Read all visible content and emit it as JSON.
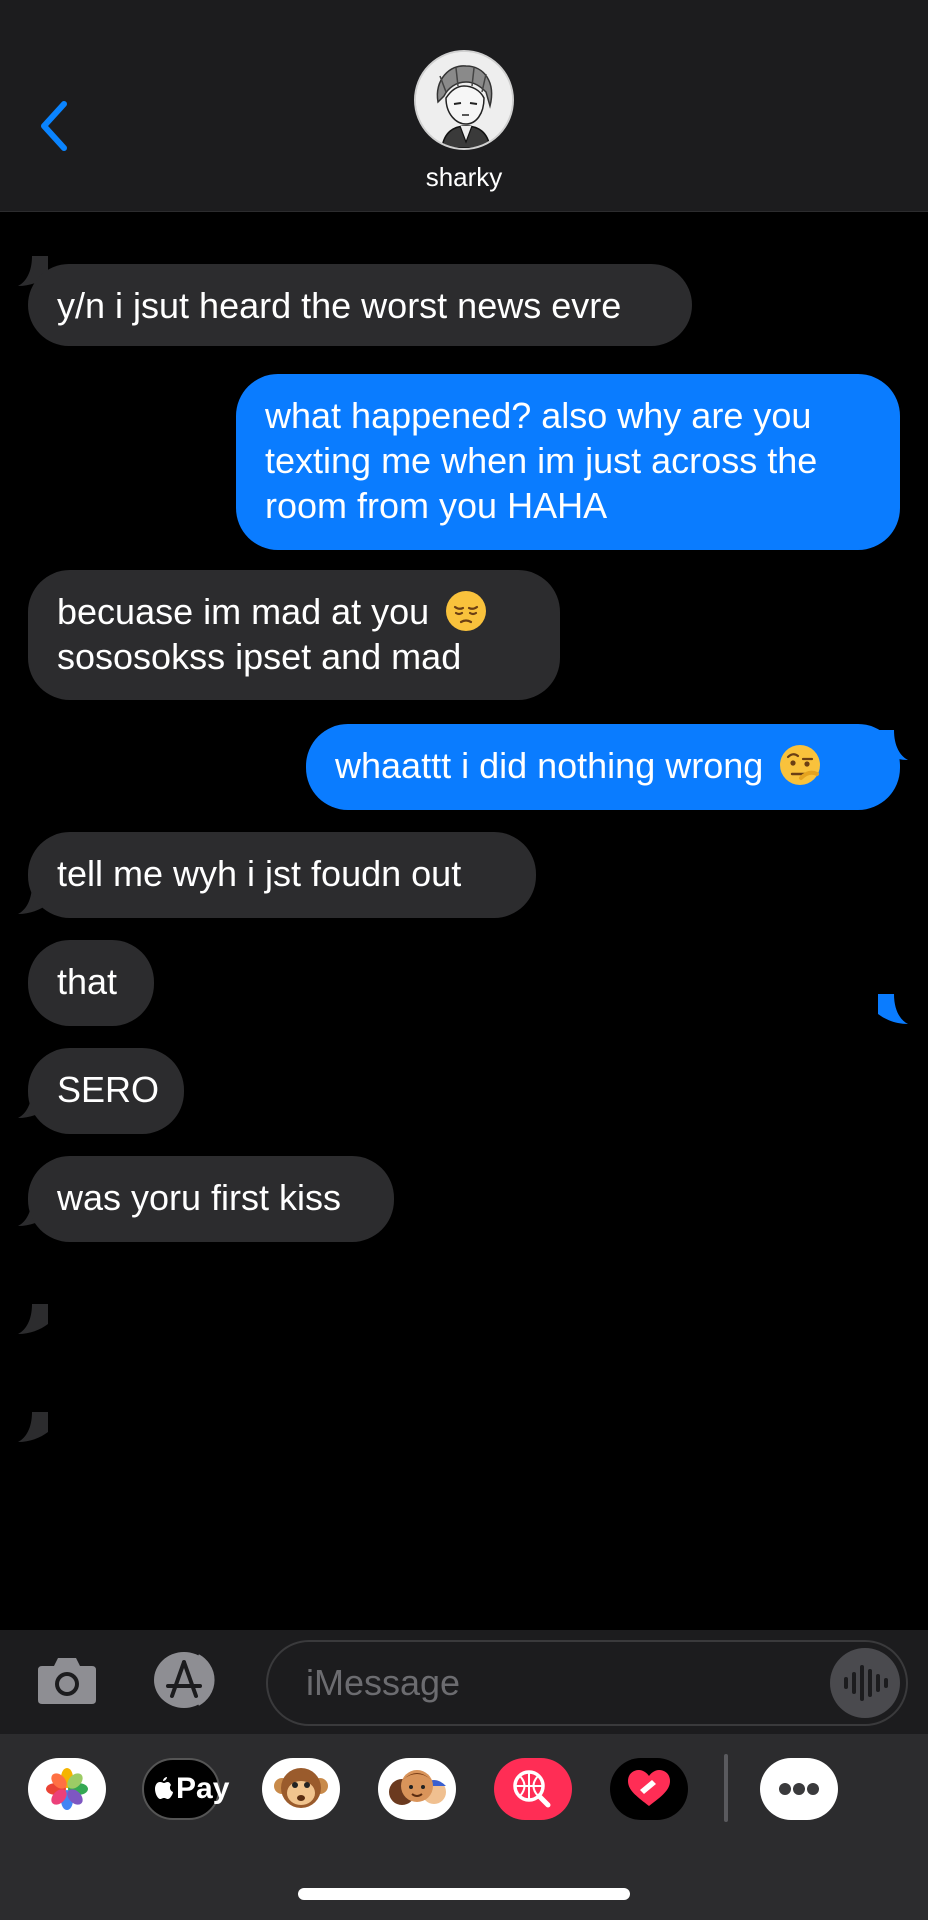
{
  "header": {
    "contact_name": "sharky"
  },
  "messages": [
    {
      "from": "them",
      "text": "y/n i jsut heard the worst news evre"
    },
    {
      "from": "me",
      "lines": [
        "what happened? also why are you",
        "texting me when im just across the",
        "room from you HAHA"
      ]
    },
    {
      "from": "them",
      "lines": [
        "becuase im mad at you",
        "sososokss ipset and mad"
      ],
      "emoji": "pensive-face"
    },
    {
      "from": "me",
      "text": "whaattt i did nothing wrong",
      "emoji": "face-with-raised-eyebrow"
    },
    {
      "from": "them",
      "text": "tell me wyh i jst foudn out"
    },
    {
      "from": "them",
      "text": "that"
    },
    {
      "from": "them",
      "text": "SERO"
    },
    {
      "from": "them",
      "text": "was yoru first kiss"
    }
  ],
  "input": {
    "placeholder": "iMessage"
  },
  "drawer": {
    "apps": [
      "photos-icon",
      "apple-pay-icon",
      "memoji-monkey-icon",
      "memoji-icon",
      "image-search-icon",
      "digital-touch-icon",
      "more-icon"
    ],
    "apple_pay_label": "Pay"
  },
  "colors": {
    "incoming_bubble": "#2c2c2e",
    "outgoing_bubble": "#0a7cff",
    "accent": "#0a84ff"
  }
}
